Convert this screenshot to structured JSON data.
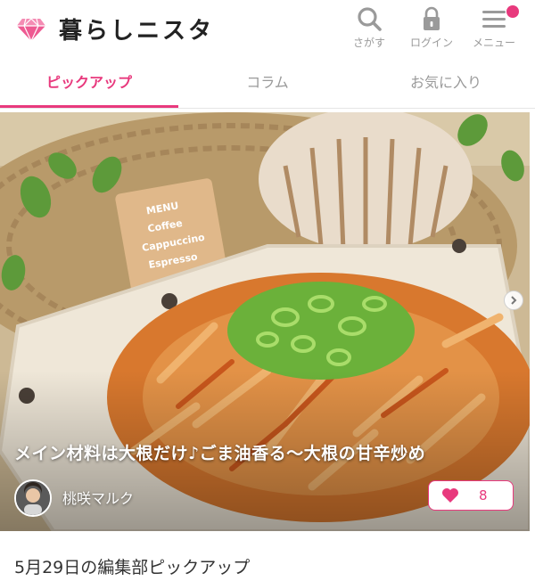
{
  "brand": {
    "name": "暮らしニスタ",
    "accent": "#e8397d"
  },
  "header": {
    "search_label": "さがす",
    "login_label": "ログイン",
    "menu_label": "メニュー"
  },
  "tabs": [
    {
      "label": "ピックアップ",
      "active": true
    },
    {
      "label": "コラム",
      "active": false
    },
    {
      "label": "お気に入り",
      "active": false
    }
  ],
  "hero": {
    "title": "メイン材料は大根だけ♪ごま油香る～大根の甘辛炒め",
    "author": "桃咲マルク",
    "likes": "8"
  },
  "section": {
    "title": "5月29日の編集部ピックアップ"
  },
  "icons": {
    "logo": "gem-icon",
    "search": "search-icon",
    "login": "lock-icon",
    "menu": "hamburger-icon",
    "like": "heart-icon",
    "next": "chevron-right-icon"
  }
}
